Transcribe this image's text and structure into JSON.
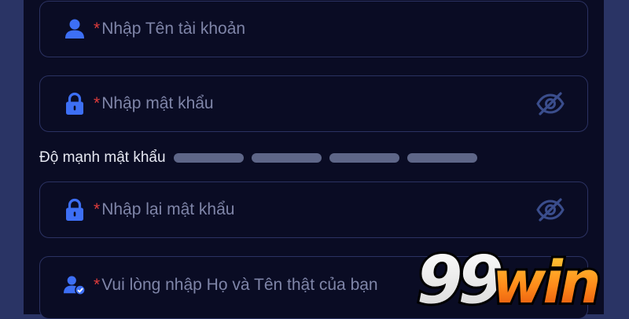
{
  "colors": {
    "page_bg": "#2a3465",
    "panel_bg": "#0a0c24",
    "field_border": "#2b3262",
    "icon_blue": "#3d6ff5",
    "required_red": "#e03c3c",
    "placeholder": "#7f85a8",
    "strength_bar": "#5e6688"
  },
  "form": {
    "username": {
      "required_mark": "*",
      "placeholder": "Nhập Tên tài khoản",
      "icon": "user-icon"
    },
    "password": {
      "required_mark": "*",
      "placeholder": "Nhập mật khẩu",
      "icon": "lock-icon",
      "toggle_icon": "eye-off-icon"
    },
    "password_strength": {
      "label": "Độ mạnh mật khẩu",
      "levels_total": 4,
      "levels_filled": 0
    },
    "confirm_password": {
      "required_mark": "*",
      "placeholder": "Nhập lại mật khẩu",
      "icon": "lock-icon",
      "toggle_icon": "eye-off-icon"
    },
    "full_name": {
      "required_mark": "*",
      "placeholder": "Vui lòng nhập Họ và Tên thật của bạn",
      "icon": "user-verified-icon"
    }
  },
  "brand": {
    "logo_text_number": "99",
    "logo_text_word": "win"
  }
}
